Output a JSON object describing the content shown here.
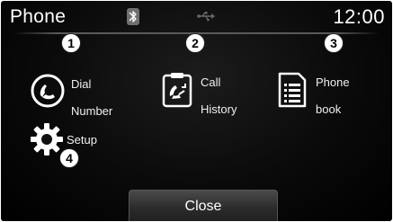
{
  "header": {
    "title": "Phone",
    "clock": "12:00"
  },
  "status_icons": [
    "bluetooth-icon",
    "usb-icon"
  ],
  "menu": {
    "dial": {
      "line1": "Dial",
      "line2": "Number",
      "icon": "phone-handset-icon"
    },
    "history": {
      "line1": "Call",
      "line2": "History",
      "icon": "call-history-icon"
    },
    "phonebook": {
      "line1": "Phone",
      "line2": "book",
      "icon": "phonebook-icon"
    },
    "setup": {
      "label": "Setup",
      "icon": "gear-icon"
    }
  },
  "callouts": [
    "1",
    "2",
    "3",
    "4"
  ],
  "close_label": "Close",
  "colors": {
    "background": "#0a0a0a",
    "text": "#ffffff",
    "bluetooth_badge": "#6f6f6f"
  }
}
